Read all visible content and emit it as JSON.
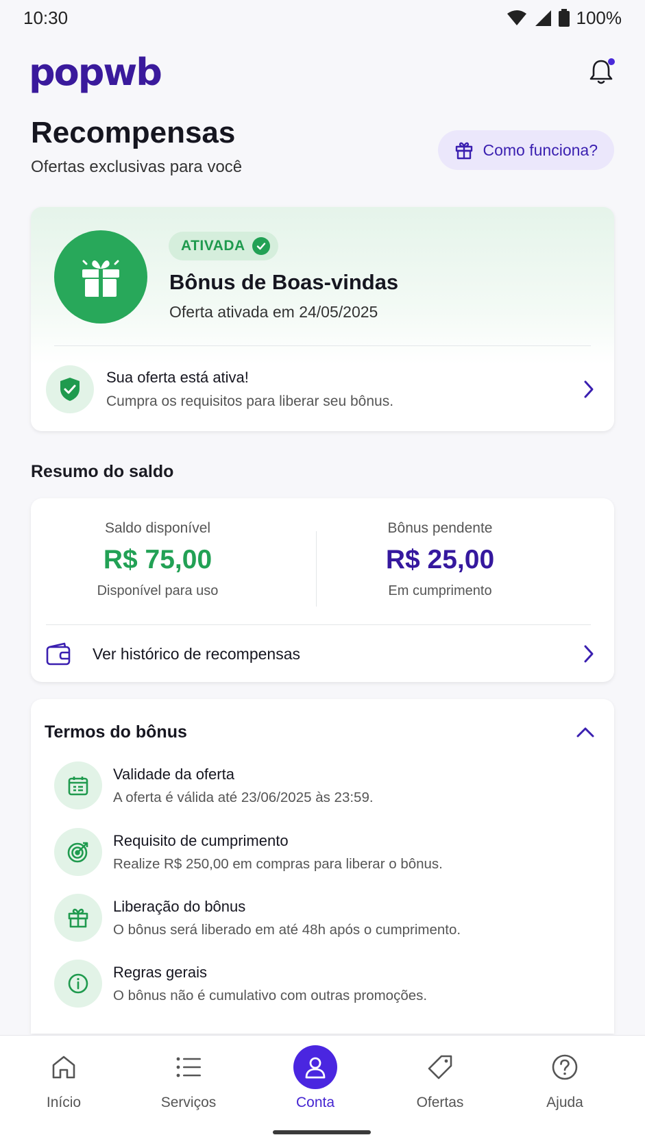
{
  "status_bar": {
    "time": "10:30",
    "battery": "100%"
  },
  "header": {
    "logo": "popwb"
  },
  "page": {
    "title": "Recompensas",
    "subtitle": "Ofertas exclusivas para você",
    "how_it_works": "Como funciona?"
  },
  "offer": {
    "badge": "ATIVADA",
    "title": "Bônus de Boas-vindas",
    "activated_on": "Oferta ativada em 24/05/2025",
    "active_title": "Sua oferta está ativa!",
    "active_desc": "Cumpra os requisitos para liberar seu bônus."
  },
  "balance": {
    "section_title": "Resumo do saldo",
    "available": {
      "label": "Saldo disponível",
      "value": "R$ 75,00",
      "sub": "Disponível para uso"
    },
    "pending": {
      "label": "Bônus pendente",
      "value": "R$ 25,00",
      "sub": "Em cumprimento"
    },
    "history_link": "Ver histórico de recompensas"
  },
  "terms": {
    "title": "Termos do bônus",
    "items": [
      {
        "icon": "calendar-icon",
        "title": "Validade da oferta",
        "desc": "A oferta é válida até 23/06/2025 às 23:59."
      },
      {
        "icon": "target-icon",
        "title": "Requisito de cumprimento",
        "desc": "Realize R$ 250,00 em compras para liberar o bônus."
      },
      {
        "icon": "gift-icon",
        "title": "Liberação do bônus",
        "desc": "O bônus será liberado em até 48h após o cumprimento."
      },
      {
        "icon": "info-icon",
        "title": "Regras gerais",
        "desc": "O bônus não é cumulativo com outras promoções."
      }
    ]
  },
  "nav": {
    "items": [
      {
        "label": "Início",
        "icon": "home-icon"
      },
      {
        "label": "Serviços",
        "icon": "list-icon"
      },
      {
        "label": "Conta",
        "icon": "user-icon",
        "active": true
      },
      {
        "label": "Ofertas",
        "icon": "tag-icon"
      },
      {
        "label": "Ajuda",
        "icon": "help-icon"
      }
    ]
  },
  "colors": {
    "brand": "#3a1a9c",
    "accent": "#4a26e0",
    "success": "#22a155"
  }
}
